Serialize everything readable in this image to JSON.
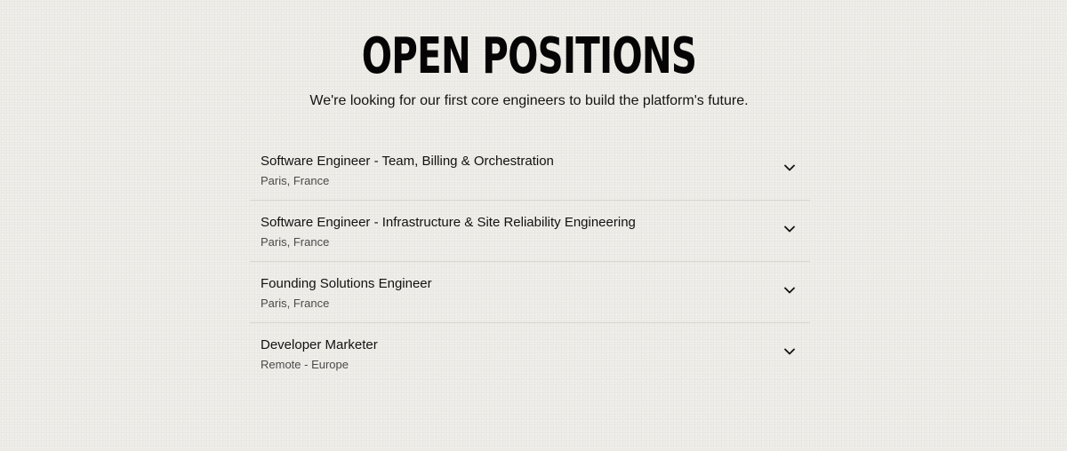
{
  "header": {
    "title": "OPEN POSITIONS",
    "subtitle": "We're looking for our first core engineers to build the platform's future."
  },
  "jobs": [
    {
      "title": "Software Engineer - Team, Billing & Orchestration",
      "location": "Paris, France"
    },
    {
      "title": "Software Engineer - Infrastructure & Site Reliability Engineering",
      "location": "Paris, France"
    },
    {
      "title": "Founding Solutions Engineer",
      "location": "Paris, France"
    },
    {
      "title": "Developer Marketer",
      "location": "Remote - Europe"
    }
  ],
  "icons": {
    "expand": "chevron-down-icon"
  },
  "colors": {
    "background": "#efede8",
    "text": "#111111",
    "muted": "#4a4a4a",
    "divider": "#d9d6d0"
  }
}
